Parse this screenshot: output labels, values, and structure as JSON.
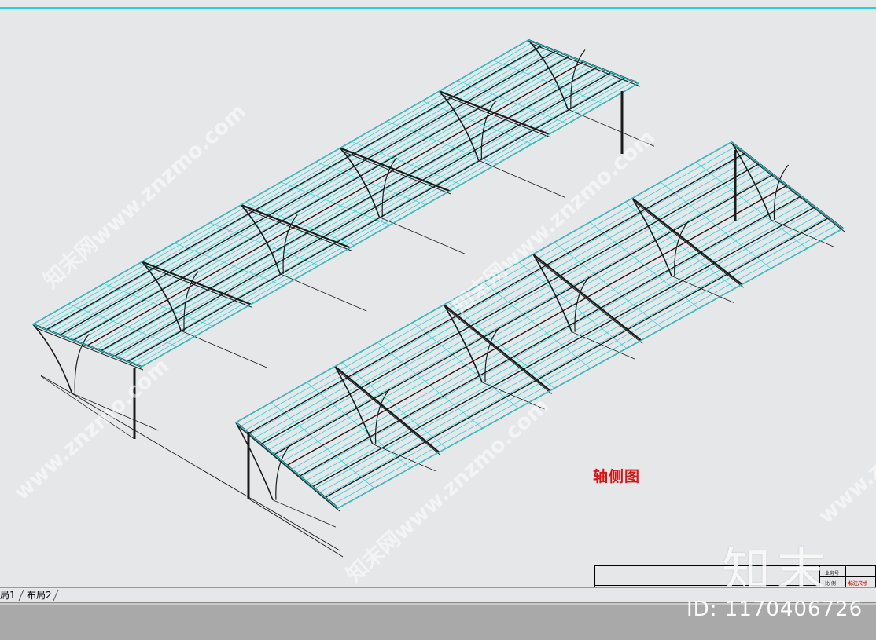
{
  "drawing": {
    "view_label": "轴侧图"
  },
  "title_block": {
    "row1_label": "业务号",
    "row2_label": "比 例",
    "row2_value": "标注尺寸"
  },
  "layout_tabs": [
    {
      "label": "局1"
    },
    {
      "label": "布局2"
    }
  ],
  "watermarks": [
    "www.znzmo.com",
    "知末网www.znzmo.com"
  ],
  "brand": {
    "logo_text": "知末",
    "image_id": "ID: 1170406726"
  },
  "colors": {
    "background": "#e6e7e8",
    "accent_cyan": "#23d4dc",
    "drawing_red": "#e01010",
    "structure": "#1a1a1a"
  }
}
